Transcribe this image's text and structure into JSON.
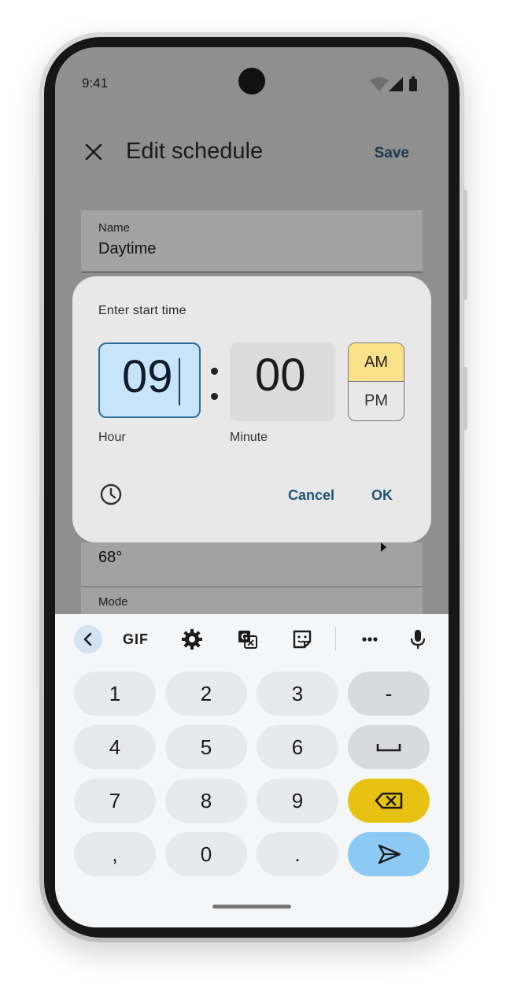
{
  "status_bar": {
    "time": "9:41"
  },
  "app_bar": {
    "title": "Edit schedule",
    "save_label": "Save"
  },
  "form": {
    "name_label": "Name",
    "name_value": "Daytime",
    "temp_value": "68°",
    "mode_label": "Mode"
  },
  "dialog": {
    "title": "Enter start time",
    "hour_value": "09",
    "minute_value": "00",
    "am_label": "AM",
    "pm_label": "PM",
    "selected_period": "AM",
    "hour_label": "Hour",
    "minute_label": "Minute",
    "cancel_label": "Cancel",
    "ok_label": "OK"
  },
  "keyboard": {
    "gif_label": "GIF",
    "keys": {
      "k1": "1",
      "k2": "2",
      "k3": "3",
      "minus": "-",
      "k4": "4",
      "k5": "5",
      "k6": "6",
      "k7": "7",
      "k8": "8",
      "k9": "9",
      "comma": ",",
      "k0": "0",
      "period": "."
    }
  },
  "colors": {
    "hour_box_bg": "#c7e4fb",
    "am_selected_bg": "#fae18a",
    "delete_key": "#e8c212",
    "send_key": "#8ccaf4",
    "accent_text": "#1f5577"
  }
}
